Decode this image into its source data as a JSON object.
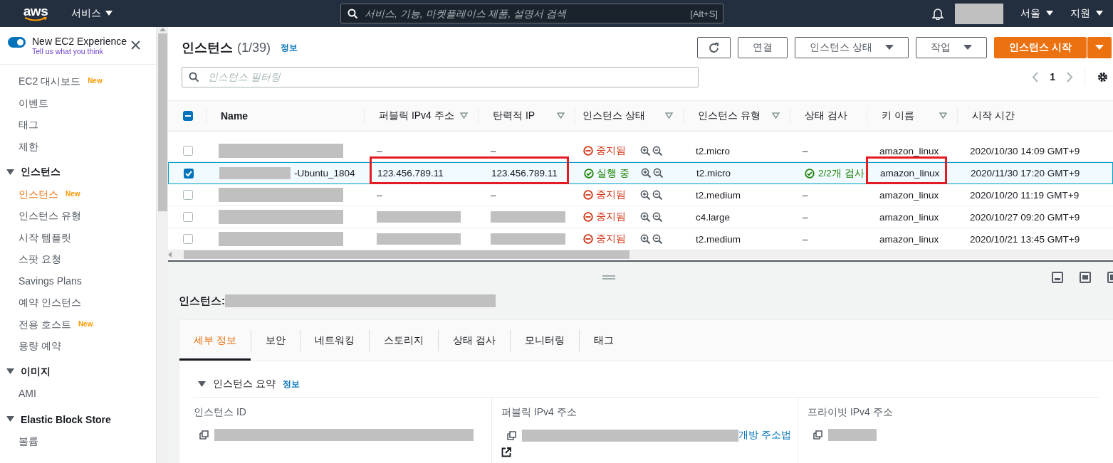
{
  "topbar": {
    "logo": "aws",
    "services": "서비스",
    "search": {
      "placeholder": "서비스, 기능, 마켓플레이스 제품, 설명서 검색",
      "shortcut": "[Alt+S]"
    },
    "account": {
      "redacted": true
    },
    "region": "서울",
    "support": "지원"
  },
  "sidebar": {
    "experience": {
      "on": true,
      "title": "New EC2 Experience",
      "feedback": "Tell us what you think"
    },
    "groups": [
      {
        "items": [
          {
            "label": "EC2 대시보드",
            "badge": "New",
            "selected": false
          },
          {
            "label": "이벤트",
            "selected": false
          },
          {
            "label": "태그",
            "selected": false
          },
          {
            "label": "제한",
            "selected": false
          }
        ]
      },
      {
        "heading": "인스턴스",
        "expanded": true,
        "items": [
          {
            "label": "인스턴스",
            "badge": "New",
            "selected": true
          },
          {
            "label": "인스턴스 유형",
            "selected": false
          },
          {
            "label": "시작 템플릿",
            "selected": false
          },
          {
            "label": "스팟 요청",
            "selected": false
          },
          {
            "label": "Savings Plans",
            "selected": false
          },
          {
            "label": "예약 인스턴스",
            "selected": false
          },
          {
            "label": "전용 호스트",
            "badge": "New",
            "selected": false
          },
          {
            "label": "용량 예약",
            "selected": false
          }
        ]
      },
      {
        "heading": "이미지",
        "expanded": true,
        "items": [
          {
            "label": "AMI",
            "selected": false
          }
        ]
      },
      {
        "heading": "Elastic Block Store",
        "expanded": true,
        "items": [
          {
            "label": "볼륨",
            "selected": false
          }
        ]
      }
    ]
  },
  "header": {
    "title": "인스턴스",
    "count": "(1/39)",
    "info": "정보",
    "buttons": [
      {
        "kind": "refresh"
      },
      {
        "kind": "plain",
        "label": "연결"
      },
      {
        "kind": "dropdown",
        "label": "인스턴스 상태"
      },
      {
        "kind": "dropdown",
        "label": "작업"
      },
      {
        "kind": "primary",
        "label": "인스턴스 시작"
      }
    ],
    "filter": {
      "placeholder": "인스턴스 필터링"
    },
    "page": "1"
  },
  "table": {
    "select_all_indeterminate": true,
    "columns": [
      {
        "label": "Name",
        "filter": false
      },
      {
        "label": "퍼블릭 IPv4 주소",
        "filter": true
      },
      {
        "label": "탄력적 IP",
        "filter": true
      },
      {
        "label": "인스턴스 상태",
        "filter": true
      },
      {
        "label": "인스턴스 유형",
        "filter": true
      },
      {
        "label": "상태 검사",
        "filter": false
      },
      {
        "label": "키 이름",
        "filter": true
      },
      {
        "label": "시작 시간",
        "filter": false
      }
    ],
    "rows": [
      {
        "selected": false,
        "name": {
          "redacted": true
        },
        "ip": {
          "text": "–"
        },
        "eip": {
          "text": "–"
        },
        "state": {
          "kind": "stopped",
          "text": "중지됨"
        },
        "type": "t2.micro",
        "check": {
          "kind": "none",
          "text": "–"
        },
        "key": "amazon_linux",
        "time": "2020/10/30 14:09 GMT+9"
      },
      {
        "selected": true,
        "highlighted": true,
        "name": {
          "redacted": true,
          "text": "-Ubuntu_1804"
        },
        "ip": {
          "text": "123.456.789.11"
        },
        "eip": {
          "text": "123.456.789.11"
        },
        "state": {
          "kind": "running",
          "text": "실행 중"
        },
        "type": "t2.micro",
        "check": {
          "kind": "passed",
          "text": "2/2개 검사"
        },
        "key": "amazon_linux",
        "time": "2020/11/30 17:20 GMT+9"
      },
      {
        "selected": false,
        "name": {
          "redacted": true
        },
        "ip": {
          "text": "–"
        },
        "eip": {
          "text": "–"
        },
        "state": {
          "kind": "stopped",
          "text": "중지됨"
        },
        "type": "t2.medium",
        "check": {
          "kind": "none",
          "text": "–"
        },
        "key": "amazon_linux",
        "time": "2020/10/20 11:19 GMT+9"
      },
      {
        "selected": false,
        "name": {
          "redacted": true
        },
        "ip": {
          "redacted": true
        },
        "eip": {
          "redacted": true
        },
        "state": {
          "kind": "stopped",
          "text": "중지됨"
        },
        "type": "c4.large",
        "check": {
          "kind": "none",
          "text": "–"
        },
        "key": "amazon_linux",
        "time": "2020/10/27 09:20 GMT+9"
      },
      {
        "selected": false,
        "name": {
          "redacted": true
        },
        "ip": {
          "redacted": true
        },
        "eip": {
          "redacted": true
        },
        "state": {
          "kind": "stopped",
          "text": "중지됨"
        },
        "type": "t2.medium",
        "check": {
          "kind": "none",
          "text": "–"
        },
        "key": "amazon_linux",
        "time": "2020/10/21 13:45 GMT+9"
      }
    ]
  },
  "detail": {
    "title": "인스턴스:",
    "redacted": true,
    "tabs": [
      {
        "label": "세부 정보",
        "selected": true
      },
      {
        "label": "보안",
        "selected": false
      },
      {
        "label": "네트워킹",
        "selected": false
      },
      {
        "label": "스토리지",
        "selected": false
      },
      {
        "label": "상태 검사",
        "selected": false
      },
      {
        "label": "모니터링",
        "selected": false
      },
      {
        "label": "태그",
        "selected": false
      }
    ],
    "section": {
      "title": "인스턴스 요약",
      "expanded": true,
      "info": "정보"
    },
    "fields": [
      {
        "label": "인스턴스 ID",
        "copy": true,
        "redacted": true
      },
      {
        "label": "퍼블릭 IPv4 주소",
        "copy": true,
        "redacted": true,
        "link": "개방 주소법",
        "external": true
      },
      {
        "label": "프라이빗 IPv4 주소",
        "copy": true,
        "redacted": true
      }
    ]
  }
}
